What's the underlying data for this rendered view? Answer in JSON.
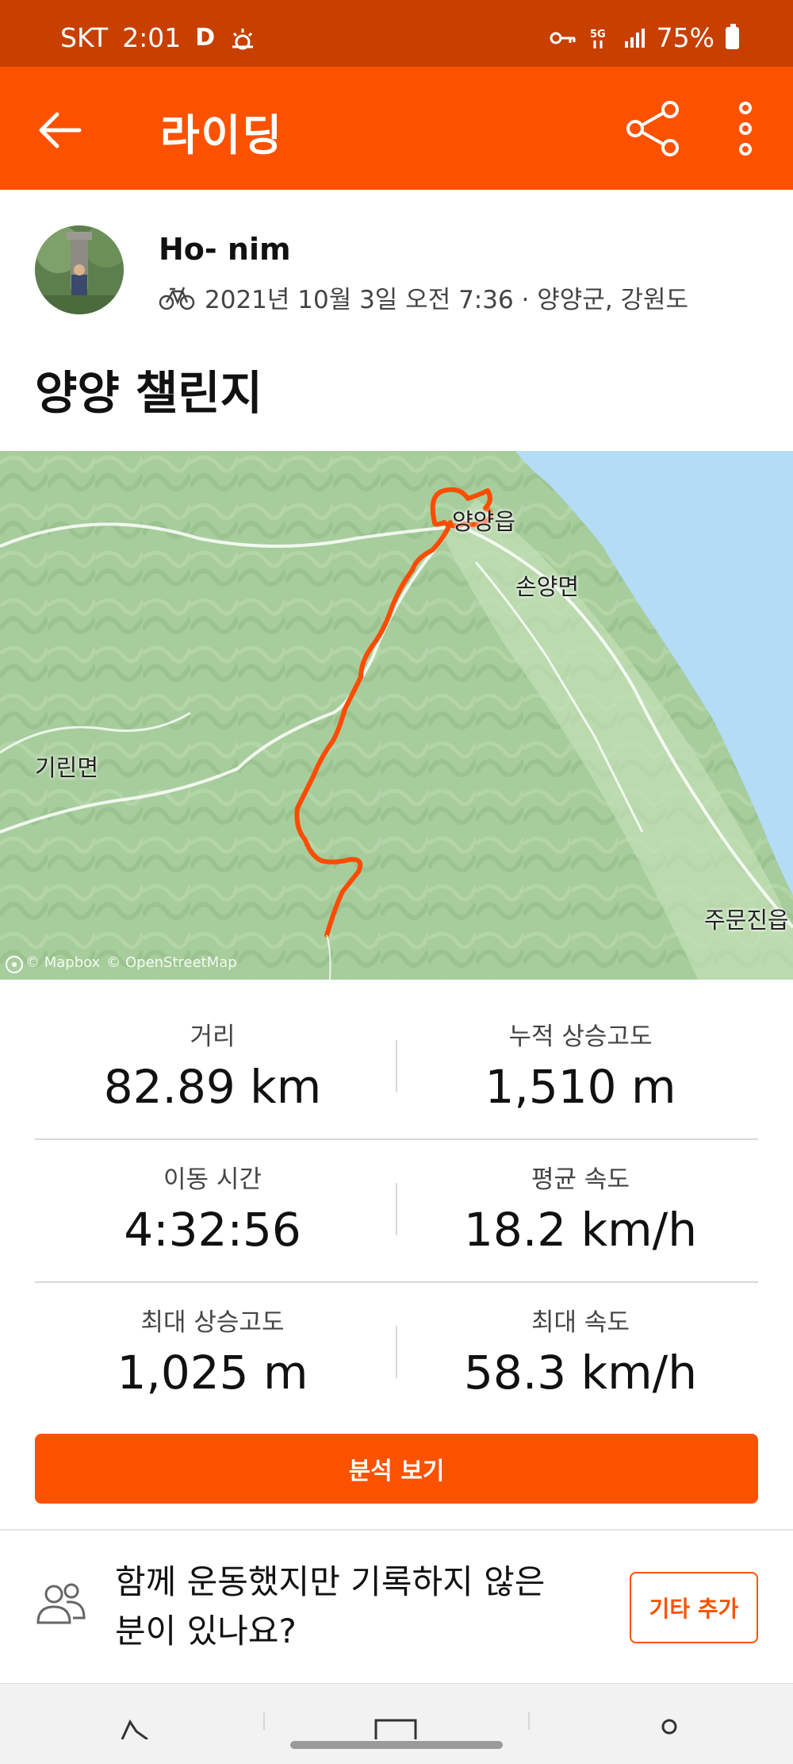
{
  "status_bar": {
    "carrier": "SKT",
    "time": "2:01",
    "d_badge": "D",
    "battery": "75%",
    "icons": [
      "weather-icon",
      "key-icon",
      "5g-icon",
      "signal-icon",
      "battery-icon"
    ]
  },
  "app_bar": {
    "title": "라이딩",
    "back_icon": "arrow-left-icon",
    "share_icon": "share-icon",
    "more_icon": "more-vertical-icon"
  },
  "activity": {
    "athlete_name": "Ho- nim",
    "sport_icon": "bicycle-icon",
    "meta": "2021년 10월 3일 오전 7:36 · 양양군, 강원도",
    "title": "양양 챌린지"
  },
  "map": {
    "labels": {
      "town_yangyang": "양양읍",
      "town_sonyang": "손양면",
      "town_girin": "기린면",
      "town_jumunjin": "주문진읍"
    },
    "attribution_mapbox": "© Mapbox",
    "attribution_osm": "© OpenStreetMap",
    "colors": {
      "route": "#fc4c02",
      "sea": "#b4dcf5",
      "land": "#a9cf9e"
    }
  },
  "stats": {
    "distance": {
      "label": "거리",
      "value": "82.89 km"
    },
    "elevation_gain": {
      "label": "누적 상승고도",
      "value": "1,510 m"
    },
    "moving_time": {
      "label": "이동 시간",
      "value": "4:32:56"
    },
    "avg_speed": {
      "label": "평균 속도",
      "value": "18.2 km/h"
    },
    "max_elevation": {
      "label": "최대 상승고도",
      "value": "1,025 m"
    },
    "max_speed": {
      "label": "최대 속도",
      "value": "58.3 km/h"
    }
  },
  "actions": {
    "analysis_button": "분석 보기",
    "invite_prompt_line1": "함께 운동했지만 기록하지 않은",
    "invite_prompt_line2": "분이 있나요?",
    "add_other_button": "기타 추가"
  },
  "theme": {
    "brand": "#fc5200",
    "status_bar": "#c74000"
  }
}
